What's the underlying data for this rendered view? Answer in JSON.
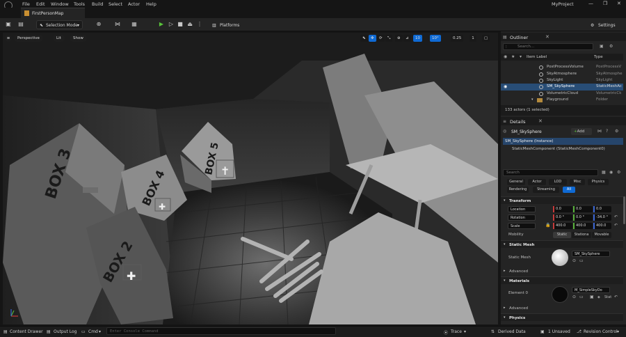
{
  "menu": [
    "File",
    "Edit",
    "Window",
    "Tools",
    "Build",
    "Select",
    "Actor",
    "Help"
  ],
  "project_name": "MyProject",
  "map_tab": "FirstPersonMap",
  "toolbar": {
    "selection_mode": "Selection Mode",
    "platforms": "Platforms",
    "settings": "Settings"
  },
  "viewport": {
    "perspective": "Perspective",
    "lit": "Lit",
    "show": "Show",
    "grid_snap": "10",
    "rot_snap": "10°",
    "scale_snap": "0.25",
    "camera_speed": "1",
    "box_labels": [
      "BOX 3",
      "BOX 4",
      "BOX 5",
      "BOX 2"
    ]
  },
  "outliner": {
    "title": "Outliner",
    "search_placeholder": "Search...",
    "col_label": "Item Label",
    "col_type": "Type",
    "rows": [
      {
        "label": "PostProcessVolume",
        "type": "PostProcessV"
      },
      {
        "label": "SkyAtmosphere",
        "type": "SkyAtmosphe"
      },
      {
        "label": "SkyLight",
        "type": "SkyLight"
      },
      {
        "label": "SM_SkySphere",
        "type": "StaticMeshAc"
      },
      {
        "label": "VolumetricCloud",
        "type": "VolumetricCk"
      },
      {
        "label": "Playground",
        "type": "Folder"
      }
    ],
    "actor_count": "133 actors (1 selected)"
  },
  "details": {
    "title": "Details",
    "actor_name": "SM_SkySphere",
    "add_label": "Add",
    "instance": "SM_SkySphere (Instance)",
    "component": "StaticMeshComponent (StaticMeshComponent0)",
    "search_placeholder": "Search",
    "filter_tabs": [
      "General",
      "Actor",
      "LOD",
      "Misc",
      "Physics",
      "Rendering",
      "Streaming",
      "All"
    ],
    "sections": {
      "transform": "Transform",
      "static_mesh": "Static Mesh",
      "advanced": "Advanced",
      "materials": "Materials",
      "advanced2": "Advanced",
      "physics": "Physics"
    },
    "location": {
      "label": "Location",
      "x": "0.0",
      "y": "0.0",
      "z": "0.0"
    },
    "rotation": {
      "label": "Rotation",
      "x": "0.0 °",
      "y": "0.0 °",
      "z": "-34.0 °"
    },
    "scale": {
      "label": "Scale",
      "x": "400.0",
      "y": "400.0",
      "z": "400.0"
    },
    "mobility": {
      "label": "Mobility",
      "options": [
        "Static",
        "Stationa",
        "Movable"
      ]
    },
    "static_mesh_label": "Static Mesh",
    "static_mesh_value": "SM_SkySphere",
    "element0_label": "Element 0",
    "element0_value": "M_SimpleSkyDo",
    "element0_type": "Stat"
  },
  "status": {
    "content_drawer": "Content Drawer",
    "output_log": "Output Log",
    "cmd": "Cmd",
    "console_placeholder": "Enter Console Command",
    "trace": "Trace",
    "derived_data": "Derived Data",
    "unsaved": "1 Unsaved",
    "revision": "Revision Control"
  }
}
